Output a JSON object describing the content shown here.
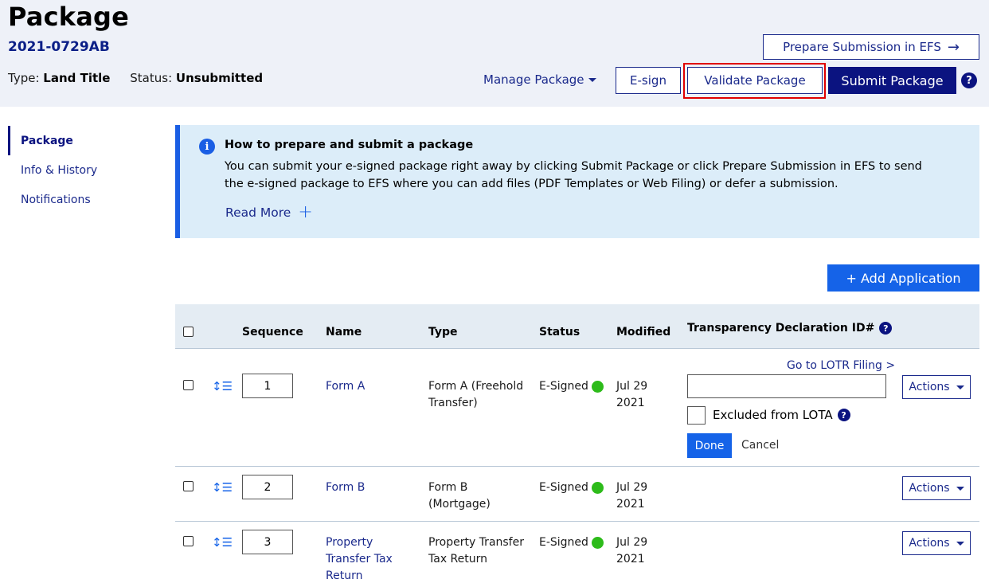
{
  "header": {
    "title": "Package",
    "package_id": "2021-0729AB",
    "type_label": "Type:",
    "type_value": "Land Title",
    "status_label": "Status:",
    "status_value": "Unsubmitted",
    "prepare_efs_label": "Prepare Submission in EFS",
    "prepare_efs_icon": "arrow-right-icon",
    "manage_package_label": "Manage Package",
    "esign_label": "E-sign",
    "validate_label": "Validate Package",
    "submit_label": "Submit Package",
    "help_glyph": "?"
  },
  "sidebar": {
    "items": [
      {
        "label": "Package",
        "active": true
      },
      {
        "label": "Info & History",
        "active": false
      },
      {
        "label": "Notifications",
        "active": false
      }
    ]
  },
  "info": {
    "icon_glyph": "i",
    "title": "How to prepare and submit a package",
    "body": "You can submit your e-signed package right away by clicking Submit Package or click Prepare Submission in EFS to send the e-signed package to EFS where you can add files (PDF Templates or Web Filing) or defer a submission.",
    "read_more": "Read More"
  },
  "add_application_label": "+ Add Application",
  "table": {
    "headers": {
      "sequence": "Sequence",
      "name": "Name",
      "type": "Type",
      "status": "Status",
      "modified": "Modified",
      "transparency": "Transparency Declaration ID#"
    },
    "actions_label": "Actions",
    "rows": [
      {
        "sequence": "1",
        "name": "Form A",
        "type": "Form A (Freehold Transfer)",
        "status": "E-Signed",
        "modified": "Jul 29 2021"
      },
      {
        "sequence": "2",
        "name": "Form B",
        "type": "Form B (Mortgage)",
        "status": "E-Signed",
        "modified": "Jul 29 2021"
      },
      {
        "sequence": "3",
        "name": "Property Transfer Tax Return",
        "type": "Property Transfer Tax Return",
        "status": "E-Signed",
        "modified": "Jul 29 2021"
      }
    ],
    "transparency_editor": {
      "lotr_link": "Go to LOTR Filing >",
      "input_value": "",
      "excluded_label": "Excluded from LOTA",
      "done_label": "Done",
      "cancel_label": "Cancel"
    }
  },
  "colors": {
    "brand_navy": "#0b1380",
    "accent_blue": "#1563e8",
    "header_bg": "#eef1f8",
    "info_bg": "#dcedf9",
    "status_green": "#2dbb1a",
    "highlight_red": "#e00000"
  }
}
